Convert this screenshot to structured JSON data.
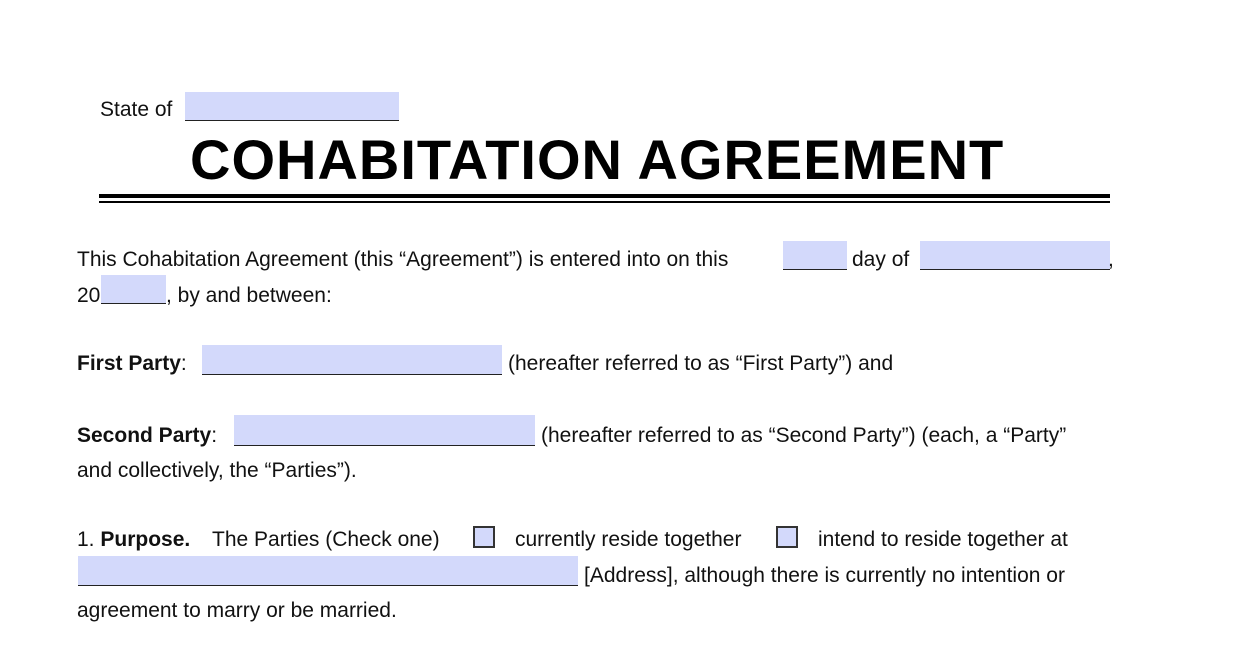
{
  "header": {
    "state_label": "State of",
    "title": "COHABITATION AGREEMENT"
  },
  "intro": {
    "part1": "This Cohabitation Agreement (this “Agreement”) is entered into on this",
    "day_of": "day of",
    "comma": ",",
    "year_prefix": "20",
    "part2": ", by and between:"
  },
  "first_party": {
    "label": "First Party",
    "colon": ":",
    "suffix": "(hereafter referred to as “First Party”) and"
  },
  "second_party": {
    "label": "Second Party",
    "colon": ":",
    "suffix": "(hereafter referred to as “Second Party”) (each, a “Party”",
    "line2": "and collectively, the “Parties”)."
  },
  "purpose": {
    "number": "1.",
    "heading": "Purpose.",
    "lead": "The Parties (Check one)",
    "option1": "currently reside together",
    "option2": "intend to reside together at",
    "address_suffix": "[Address], although there is currently no intention or",
    "line3": "agreement to marry or be married."
  },
  "colors": {
    "field_fill": "#d3d9fb",
    "text": "#111111"
  }
}
